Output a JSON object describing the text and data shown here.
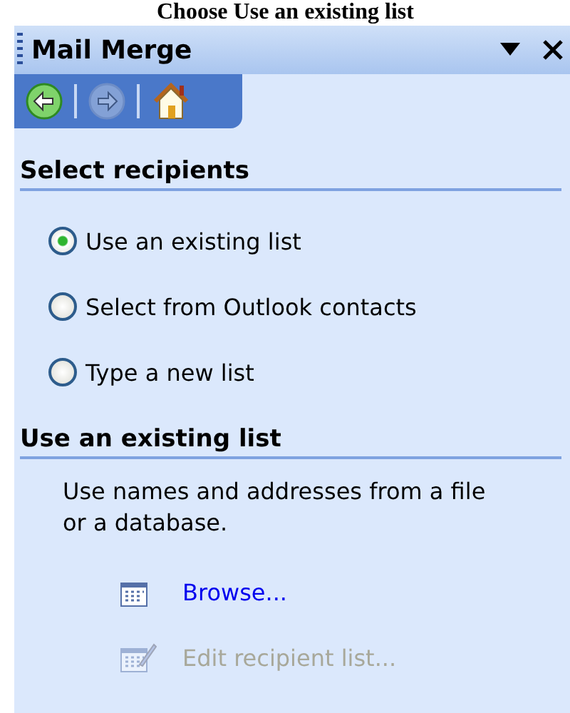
{
  "document_text": "Choose Use an existing list",
  "pane": {
    "title": "Mail Merge"
  },
  "nav": [
    {
      "kind": "back",
      "disabled": false
    },
    {
      "kind": "forward",
      "disabled": true
    },
    {
      "kind": "home",
      "disabled": false
    }
  ],
  "sections": [
    {
      "heading": "Select recipients",
      "options": [
        {
          "label": "Use an existing list",
          "selected": true
        },
        {
          "label": "Select from Outlook contacts",
          "selected": false
        },
        {
          "label": "Type a new list",
          "selected": false
        }
      ]
    },
    {
      "heading": "Use an existing list",
      "text": "Use names and addresses from a file or a database.",
      "links": [
        {
          "label": "Browse...",
          "disabled": false
        },
        {
          "label": "Edit recipient list...",
          "disabled": true
        }
      ]
    }
  ]
}
